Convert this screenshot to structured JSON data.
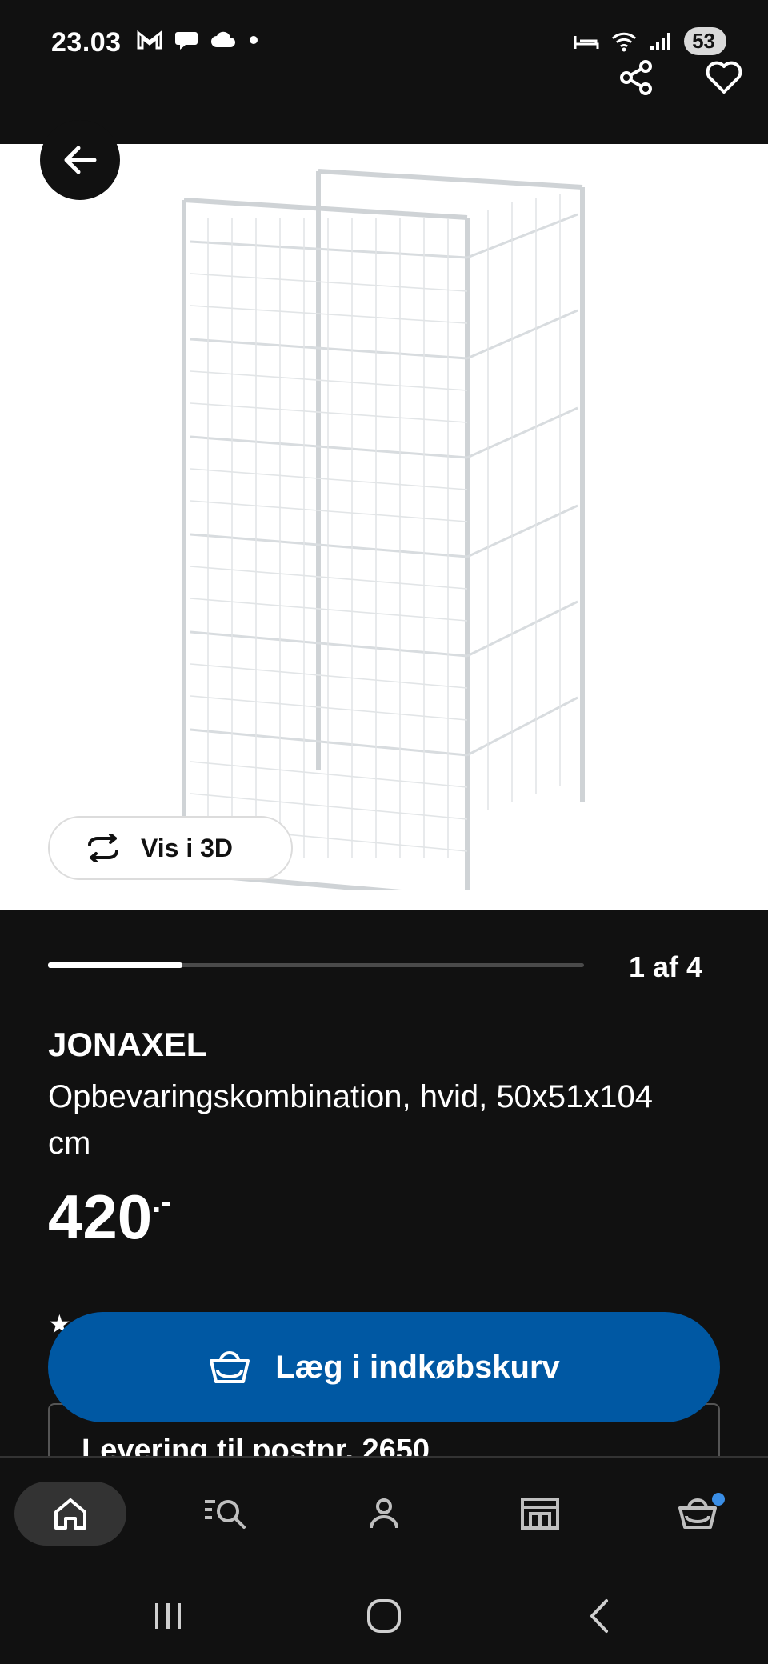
{
  "status_bar": {
    "time": "23.03",
    "battery": "53",
    "icons_left": [
      "gmail-icon",
      "chat-icon",
      "cloud-icon",
      "dot-icon"
    ],
    "icons_right": [
      "sleep-icon",
      "wifi-icon",
      "signal-icon",
      "battery-icon"
    ]
  },
  "header": {
    "back_icon": "arrow-left-icon",
    "share_icon": "share-icon",
    "favorite_icon": "heart-icon"
  },
  "gallery": {
    "view_3d_label": "Vis i 3D",
    "counter": "1 af 4",
    "progress_fraction": 0.25
  },
  "product": {
    "name": "JONAXEL",
    "description": "Opbevaringskombination, hvid, 50x51x104 cm",
    "price": "420",
    "price_suffix": ".-"
  },
  "actions": {
    "add_to_cart_label": "Læg i indkøbskurv",
    "delivery_label": "Levering til postnr. 2650"
  },
  "bottom_nav": {
    "items": [
      {
        "name": "home",
        "icon": "home-icon",
        "active": true
      },
      {
        "name": "search",
        "icon": "search-list-icon",
        "active": false
      },
      {
        "name": "profile",
        "icon": "person-icon",
        "active": false
      },
      {
        "name": "stores",
        "icon": "store-icon",
        "active": false
      },
      {
        "name": "cart",
        "icon": "basket-icon",
        "active": false
      }
    ]
  },
  "colors": {
    "background": "#111111",
    "primary_button": "#0058a3",
    "notification_dot": "#3a8ee6"
  }
}
